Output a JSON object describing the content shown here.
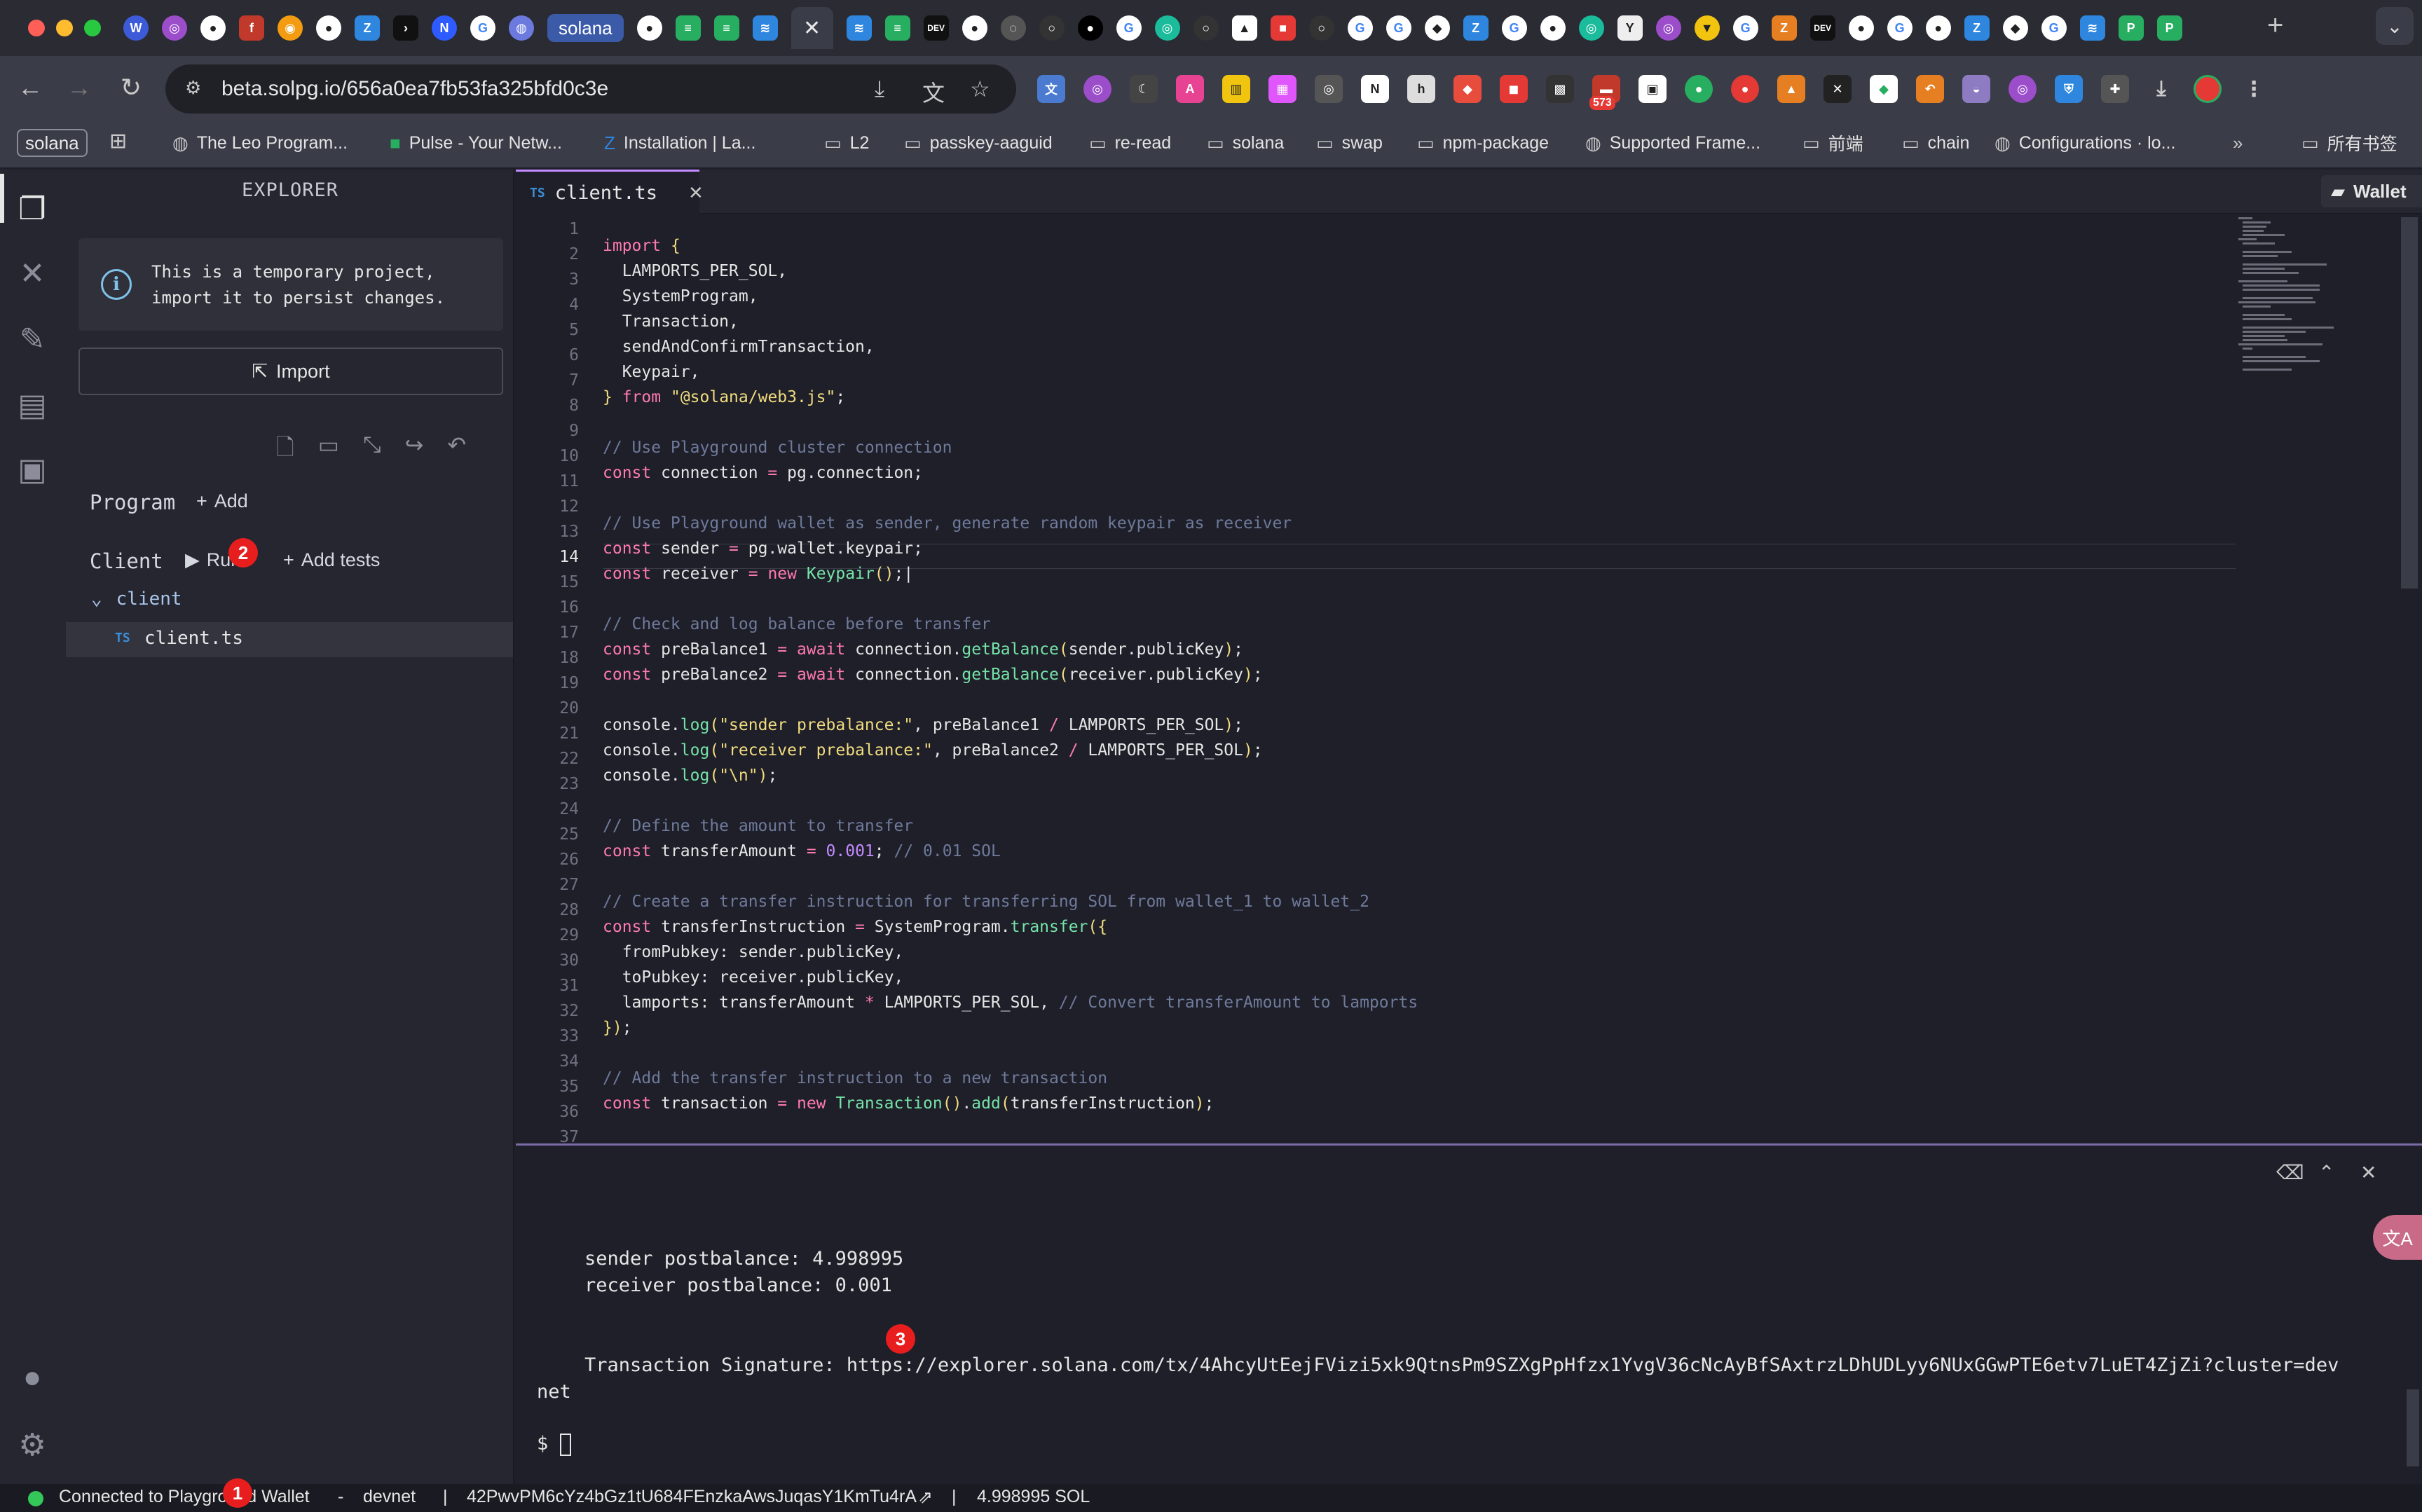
{
  "browser": {
    "active_tab_label": "solana",
    "url": "beta.solpg.io/656a0ea7fb53fa325bfd0c3e",
    "extension_badge": "573",
    "bookmarks": {
      "chip": "solana",
      "items": [
        "The Leo Program...",
        "Pulse - Your Netw...",
        "Installation | La...",
        "L2",
        "passkey-aaguid",
        "re-read",
        "solana",
        "swap",
        "npm-package",
        "Supported Frame...",
        "前端",
        "chain",
        "Configurations · lo..."
      ],
      "all_bookmarks": "所有书签"
    }
  },
  "sidebar": {
    "title": "EXPLORER",
    "notice": "This is a temporary project,\nimport it to persist changes.",
    "import_label": "Import",
    "program_label": "Program",
    "program_add": "Add",
    "client_label": "Client",
    "run_label": "Run",
    "add_tests": "Add tests",
    "folder": "client",
    "file_badge": "TS",
    "file": "client.ts"
  },
  "markers": [
    "1",
    "2",
    "3"
  ],
  "editor": {
    "tab_badge": "TS",
    "tab_title": "client.ts",
    "wallet_label": "Wallet",
    "current_line": 14,
    "line_numbers": [
      "1",
      "2",
      "3",
      "4",
      "5",
      "6",
      "7",
      "8",
      "9",
      "10",
      "11",
      "12",
      "13",
      "14",
      "15",
      "16",
      "17",
      "18",
      "19",
      "20",
      "21",
      "22",
      "23",
      "24",
      "25",
      "26",
      "27",
      "28",
      "29",
      "30",
      "31",
      "32",
      "33",
      "34",
      "35",
      "36",
      "37"
    ]
  },
  "terminal": {
    "lines": [
      "sender postbalance: 4.998995",
      "receiver postbalance: 0.001",
      "Transaction Signature: https://explorer.solana.com/tx/4AhcyUtEejFVizi5xk9QtnsPm9SZXgPpHfzx1YvgV36cNcAyBfSAxtrzLDhUDLyy6NUxGGwPTE6etv7LuET4ZjZi?cluster=dev",
      "net"
    ],
    "prompt": "$"
  },
  "status": {
    "connection": "Connected to Playground Wallet",
    "sep1": "-",
    "network": "devnet",
    "sep2": "|",
    "address": "42PwvPM6cYz4bGz1tU684FEnzkaAwsJuqasY1KmTu4rA",
    "sep3": "|",
    "balance": "4.998995 SOL"
  },
  "colors": {
    "accent": "#c38bff",
    "keyword": "#ff7ab2",
    "function": "#76e3a8",
    "string": "#f1dc7f",
    "comment": "#6f7a9a",
    "marker": "#e81e1e",
    "status_ok": "#34c759"
  }
}
